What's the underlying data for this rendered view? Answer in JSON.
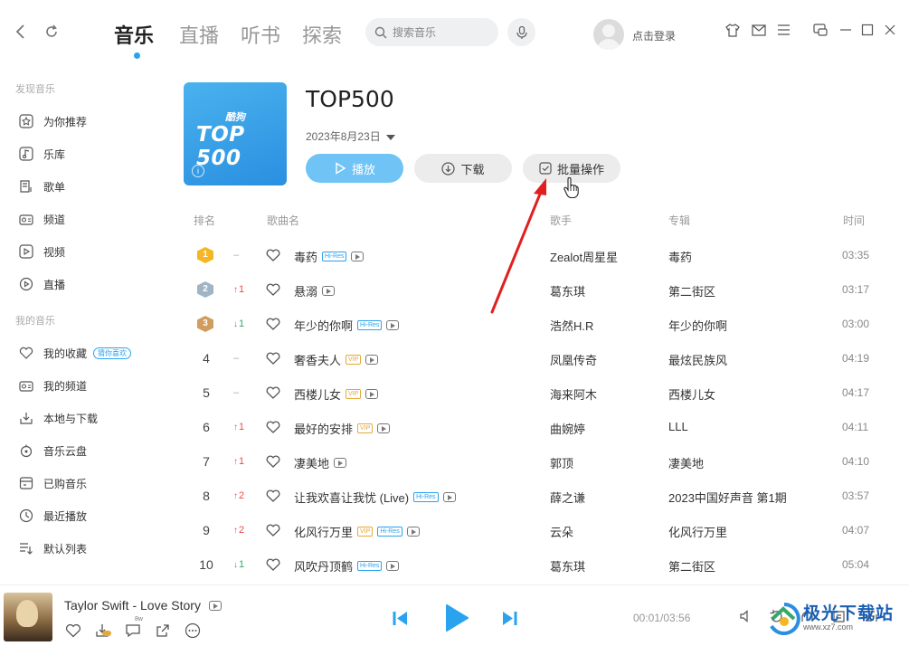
{
  "nav": {
    "tabs": [
      {
        "label": "音乐",
        "active": true
      },
      {
        "label": "直播"
      },
      {
        "label": "听书"
      },
      {
        "label": "探索"
      }
    ],
    "search_placeholder": "搜索音乐",
    "login_label": "点击登录"
  },
  "sidebar": {
    "section1_title": "发现音乐",
    "section1": [
      {
        "label": "为你推荐",
        "icon": "star-icon"
      },
      {
        "label": "乐库",
        "icon": "music-note-icon"
      },
      {
        "label": "歌单",
        "icon": "playlist-icon"
      },
      {
        "label": "频道",
        "icon": "radio-icon"
      },
      {
        "label": "视频",
        "icon": "video-icon"
      },
      {
        "label": "直播",
        "icon": "live-icon"
      }
    ],
    "section2_title": "我的音乐",
    "section2": [
      {
        "label": "我的收藏",
        "icon": "heart-icon",
        "badge": "猜你喜欢"
      },
      {
        "label": "我的频道",
        "icon": "radio-icon"
      },
      {
        "label": "本地与下载",
        "icon": "download-icon"
      },
      {
        "label": "音乐云盘",
        "icon": "cloud-icon"
      },
      {
        "label": "已购音乐",
        "icon": "purchased-icon"
      },
      {
        "label": "最近播放",
        "icon": "clock-icon"
      },
      {
        "label": "默认列表",
        "icon": "list-icon"
      }
    ]
  },
  "playlist": {
    "cover_small": "酷狗",
    "cover_big": "TOP 500",
    "title": "TOP500",
    "date": "2023年8月23日",
    "play_label": "播放",
    "download_label": "下载",
    "batch_label": "批量操作"
  },
  "table": {
    "headers": {
      "rank": "排名",
      "song": "歌曲名",
      "artist": "歌手",
      "album": "专辑",
      "time": "时间"
    },
    "rows": [
      {
        "rank": "1",
        "change": "–",
        "dir": "flat",
        "name": "毒药",
        "tags": [
          "Hi-Res"
        ],
        "artist": "Zealot周星星",
        "album": "毒药",
        "time": "03:35"
      },
      {
        "rank": "2",
        "change": "1",
        "dir": "up",
        "name": "悬溺",
        "tags": [],
        "artist": "葛东琪",
        "album": "第二街区",
        "time": "03:17"
      },
      {
        "rank": "3",
        "change": "1",
        "dir": "down",
        "name": "年少的你啊",
        "tags": [
          "Hi-Res"
        ],
        "artist": "浩然H.R",
        "album": "年少的你啊",
        "time": "03:00"
      },
      {
        "rank": "4",
        "change": "–",
        "dir": "flat",
        "name": "奢香夫人",
        "tags": [
          "VIP"
        ],
        "artist": "凤凰传奇",
        "album": "最炫民族风",
        "time": "04:19"
      },
      {
        "rank": "5",
        "change": "–",
        "dir": "flat",
        "name": "西楼儿女",
        "tags": [
          "VIP"
        ],
        "artist": "海来阿木",
        "album": "西楼儿女",
        "time": "04:17"
      },
      {
        "rank": "6",
        "change": "1",
        "dir": "up",
        "name": "最好的安排",
        "tags": [
          "VIP"
        ],
        "artist": "曲婉婷",
        "album": "LLL",
        "time": "04:11"
      },
      {
        "rank": "7",
        "change": "1",
        "dir": "up",
        "name": "凄美地",
        "tags": [],
        "artist": "郭顶",
        "album": "凄美地",
        "time": "04:10"
      },
      {
        "rank": "8",
        "change": "2",
        "dir": "up",
        "name": "让我欢喜让我忧 (Live)",
        "tags": [
          "Hi-Res"
        ],
        "artist": "薛之谦",
        "album": "2023中国好声音 第1期",
        "time": "03:57"
      },
      {
        "rank": "9",
        "change": "2",
        "dir": "up",
        "name": "化风行万里",
        "tags": [
          "VIP",
          "Hi-Res"
        ],
        "artist": "云朵",
        "album": "化风行万里",
        "time": "04:07"
      },
      {
        "rank": "10",
        "change": "1",
        "dir": "down",
        "name": "风吹丹顶鹤",
        "tags": [
          "Hi-Res"
        ],
        "artist": "葛东琪",
        "album": "第二街区",
        "time": "05:04"
      }
    ]
  },
  "player": {
    "now_playing": "Taylor Swift - Love Story",
    "time": "00:01/03:56",
    "quality_badge": "8w",
    "watermark": "极光下载站",
    "watermark_sub": "www.xz7.com"
  },
  "colors": {
    "accent": "#2aa3ef",
    "play_button": "#6fc3f5",
    "rank_gold": "#f5b623",
    "rank_silver": "#9fb5c6",
    "rank_bronze": "#d19d5f",
    "up": "#e84b4b",
    "down": "#35a86b",
    "annotation_arrow": "#e02020"
  }
}
